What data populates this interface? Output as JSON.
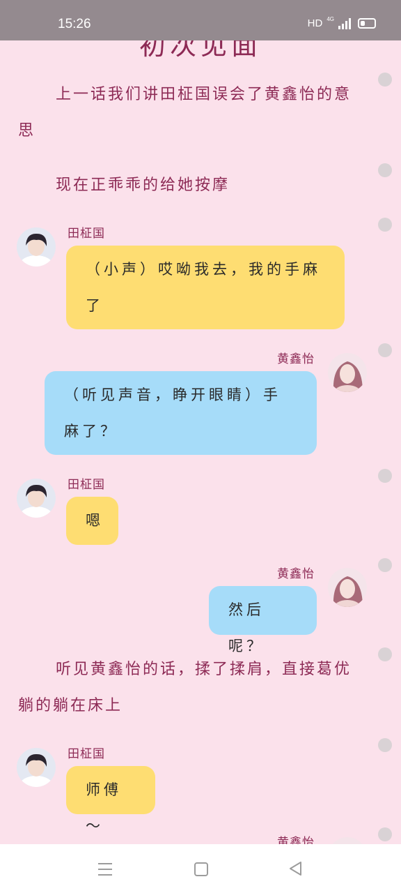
{
  "status_bar": {
    "time": "15:26",
    "hd": "HD",
    "network": "4G"
  },
  "chapter_title": "初次见面",
  "messages": [
    {
      "type": "narration",
      "text": "上一话我们讲田柾国误会了黄鑫怡的意思"
    },
    {
      "type": "narration",
      "text": "现在正乖乖的给她按摩"
    },
    {
      "type": "chat",
      "speaker": "田柾国",
      "text": "（小声）哎呦我去，我的手麻了",
      "bubble_color": "#fedd72"
    },
    {
      "type": "chat",
      "speaker": "黄鑫怡",
      "text": "（听见声音，睁开眼睛）手麻了？",
      "bubble_color": "#a6dcf9"
    },
    {
      "type": "chat",
      "speaker": "田柾国",
      "text": "嗯",
      "bubble_color": "#fedd72"
    },
    {
      "type": "chat",
      "speaker": "黄鑫怡",
      "text": "然后呢？",
      "bubble_color": "#a6dcf9"
    },
    {
      "type": "narration",
      "text": "听见黄鑫怡的话，揉了揉肩，直接葛优躺的躺在床上"
    },
    {
      "type": "chat",
      "speaker": "田柾国",
      "text": "师傅～",
      "bubble_color": "#fedd72"
    },
    {
      "type": "chat",
      "speaker": "黄鑫怡",
      "text": "",
      "bubble_color": "#a6dcf9"
    }
  ],
  "nav_bar": {
    "menu_icon": "menu-icon",
    "home_icon": "home-icon",
    "back_icon": "back-icon"
  },
  "colors": {
    "background": "#fbe1eb",
    "accent_text": "#8d2a55",
    "yellow_bubble": "#fedd72",
    "blue_bubble": "#a6dcf9"
  }
}
